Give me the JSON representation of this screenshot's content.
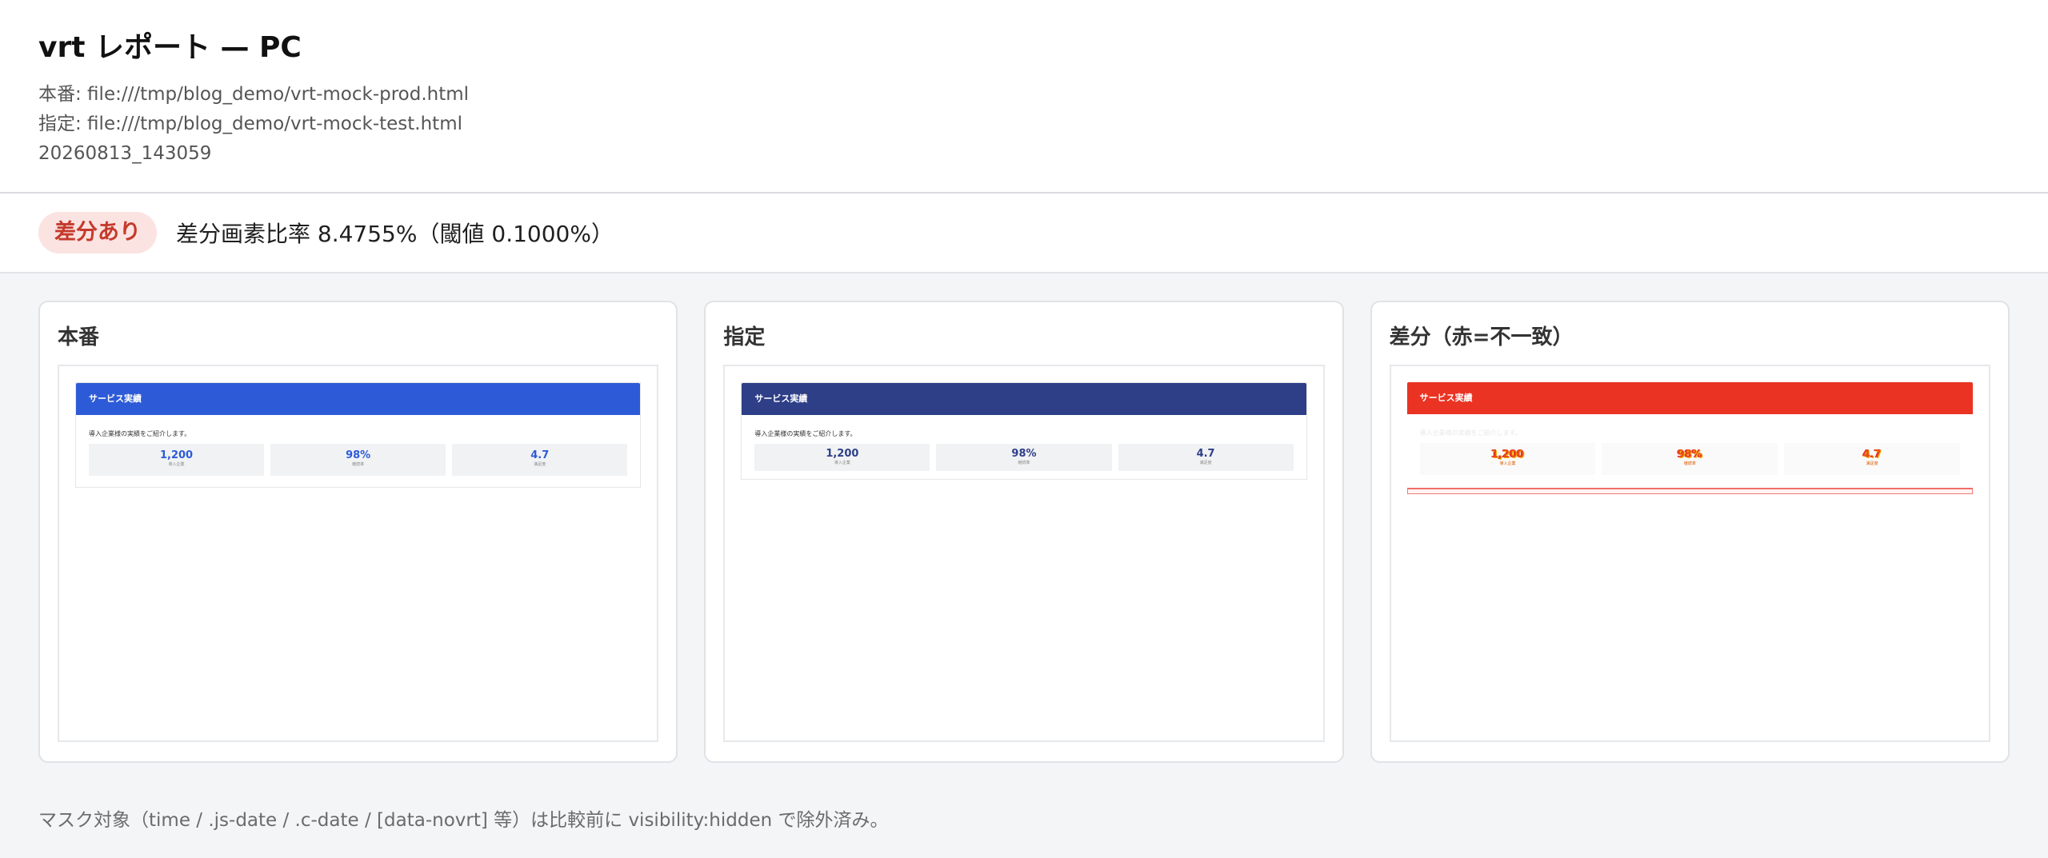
{
  "header": {
    "title": "vrt レポート — PC",
    "prod_line": "本番: file:///tmp/blog_demo/vrt-mock-prod.html",
    "test_line": "指定: file:///tmp/blog_demo/vrt-mock-test.html",
    "timestamp": "20260813_143059"
  },
  "summary": {
    "badge": "差分あり",
    "text": "差分画素比率 8.4755%（閾値 0.1000%）",
    "badge_color": "#c43a2c"
  },
  "panels": [
    {
      "title": "本番",
      "mock": {
        "header": "サービス実績",
        "lead": "導入企業様の実績をご紹介します。",
        "stats": [
          {
            "value": "1,200",
            "label": "導入企業"
          },
          {
            "value": "98%",
            "label": "継続率"
          },
          {
            "value": "4.7",
            "label": "満足度"
          }
        ],
        "accent": "#2d5bd8"
      }
    },
    {
      "title": "指定",
      "mock": {
        "header": "サービス実績",
        "lead": "導入企業様の実績をご紹介します。",
        "stats": [
          {
            "value": "1,200",
            "label": "導入企業"
          },
          {
            "value": "98%",
            "label": "継続率"
          },
          {
            "value": "4.7",
            "label": "満足度"
          }
        ],
        "accent": "#2e3f88"
      }
    },
    {
      "title": "差分（赤=不一致）",
      "mock": {
        "header": "サービス実績",
        "lead": "導入企業様の実績をご紹介します。",
        "stats": [
          {
            "value": "1,200",
            "label": "導入企業"
          },
          {
            "value": "98%",
            "label": "継続率"
          },
          {
            "value": "4.7",
            "label": "満足度"
          }
        ],
        "accent": "#ea3323"
      }
    }
  ],
  "footnote": "マスク対象（time / .js-date / .c-date / [data-novrt] 等）は比較前に visibility:hidden で除外済み。"
}
